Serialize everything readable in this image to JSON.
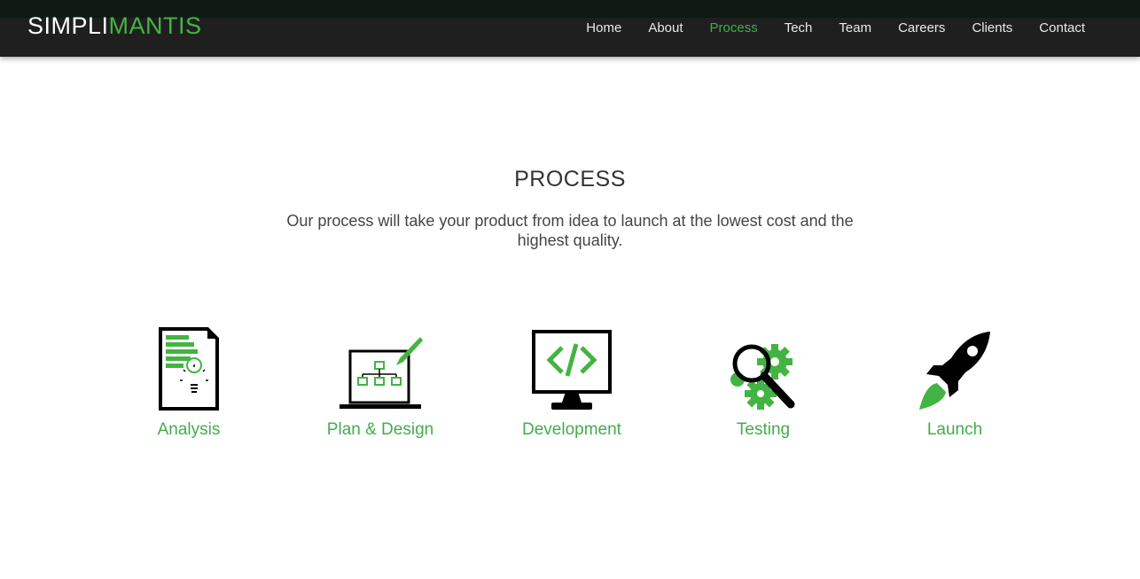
{
  "brand": {
    "part1": "SIMPLI",
    "part2": "MANTIS"
  },
  "nav": {
    "items": [
      "Home",
      "About",
      "Process",
      "Tech",
      "Team",
      "Careers",
      "Clients",
      "Contact"
    ],
    "active": "Process"
  },
  "section": {
    "title": "PROCESS",
    "subtitle": "Our process will take your product from idea to launch at the lowest cost and the highest quality."
  },
  "steps": [
    {
      "label": "Analysis",
      "icon": "document-lightbulb-icon"
    },
    {
      "label": "Plan & Design",
      "icon": "laptop-sitemap-icon"
    },
    {
      "label": "Development",
      "icon": "monitor-code-icon"
    },
    {
      "label": "Testing",
      "icon": "magnifier-gears-icon"
    },
    {
      "label": "Launch",
      "icon": "rocket-icon"
    }
  ],
  "colors": {
    "accent": "#43b443",
    "navbar": "#1f1f1f",
    "nav_text": "#e8e8e8"
  }
}
